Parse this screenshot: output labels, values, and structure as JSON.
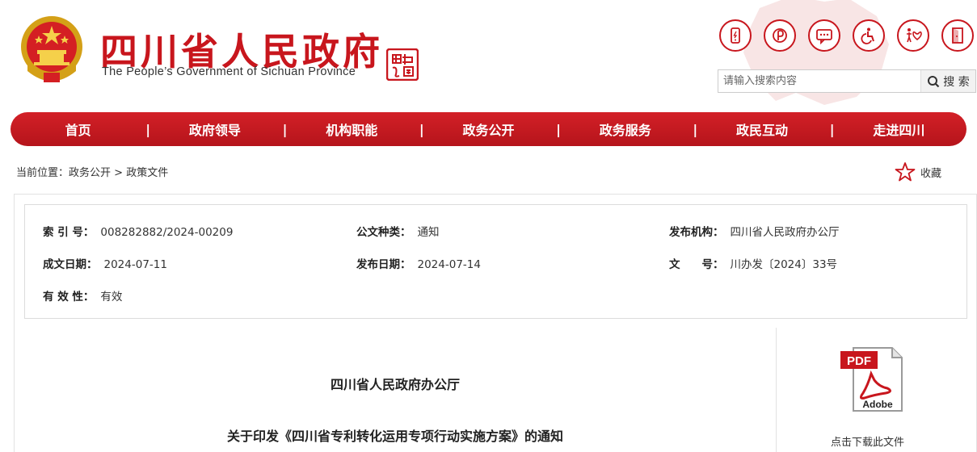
{
  "header": {
    "title": "四川省人民政府",
    "subtitle": "The People’s Government of Sichuan Province",
    "tool_icons": [
      "mobile-icon",
      "weibo-icon",
      "message-icon",
      "accessibility-icon",
      "care-icon",
      "exit-icon"
    ]
  },
  "search": {
    "placeholder": "请输入搜索内容",
    "button_label": "搜 索"
  },
  "nav": {
    "items": [
      "首页",
      "政府领导",
      "机构职能",
      "政务公开",
      "政务服务",
      "政民互动",
      "走进四川"
    ],
    "separator": "|"
  },
  "breadcrumb": {
    "prefix": "当前位置：",
    "level1": "政务公开",
    "sep": " > ",
    "level2": "政策文件"
  },
  "favorite_label": "收藏",
  "meta": {
    "index_label": "索 引 号：",
    "index_value": "008282882/2024-00209",
    "type_label": "公文种类：",
    "type_value": "通知",
    "publisher_label": "发布机构：",
    "publisher_value": "四川省人民政府办公厅",
    "created_label": "成文日期：",
    "created_value": "2024-07-11",
    "published_label": "发布日期：",
    "published_value": "2024-07-14",
    "docno_label": "文　　号：",
    "docno_value": "川办发〔2024〕33号",
    "validity_label": "有 效 性：",
    "validity_value": "有效"
  },
  "document": {
    "issuer": "四川省人民政府办公厅",
    "title": "关于印发《四川省专利转化运用专项行动实施方案》的通知"
  },
  "download": {
    "pdf_badge": "PDF",
    "adobe_label": "Adobe",
    "label": "点击下载此文件"
  },
  "colors": {
    "brand_red": "#c8161d",
    "nav_red": "#c41a21"
  }
}
